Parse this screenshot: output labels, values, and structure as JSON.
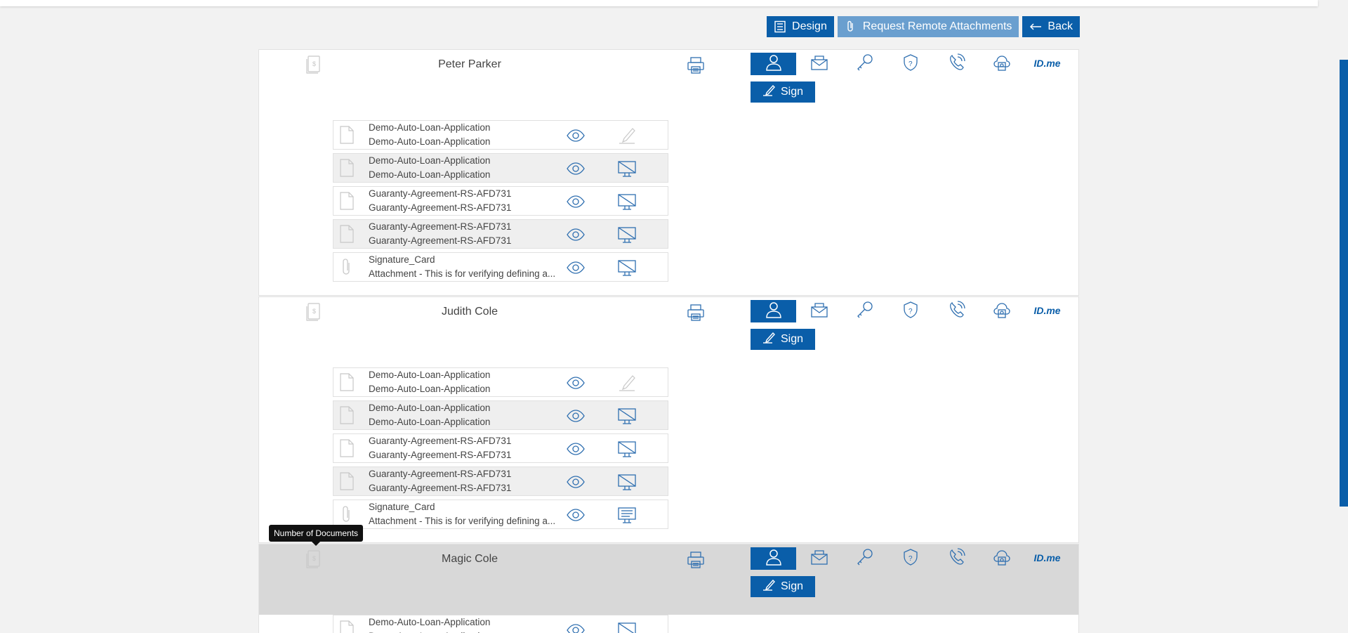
{
  "toolbar": {
    "design_label": "Design",
    "request_label": "Request Remote Attachments",
    "back_label": "Back"
  },
  "tooltip": "Number of Documents",
  "auth_methods": [
    "person-icon",
    "email-icon",
    "key-icon",
    "shield-question-icon",
    "phone-icon",
    "cloud-id-icon",
    "idme-logo"
  ],
  "idme": {
    "id": "ID",
    "me": ".me"
  },
  "sign_label": "Sign",
  "signers": [
    {
      "name": "Peter Parker",
      "docs": [
        {
          "line1": "Demo-Auto-Loan-Application",
          "line2": "Demo-Auto-Loan-Application",
          "icon": "file-icon",
          "action": "pen-icon"
        },
        {
          "line1": "Demo-Auto-Loan-Application",
          "line2": "Demo-Auto-Loan-Application",
          "icon": "file-icon",
          "action": "no-screen-icon"
        },
        {
          "line1": "Guaranty-Agreement-RS-AFD731",
          "line2": "Guaranty-Agreement-RS-AFD731",
          "icon": "file-icon",
          "action": "no-screen-icon"
        },
        {
          "line1": "Guaranty-Agreement-RS-AFD731",
          "line2": "Guaranty-Agreement-RS-AFD731",
          "icon": "file-icon",
          "action": "no-screen-icon"
        },
        {
          "line1": "Signature_Card",
          "line2": "Attachment - This is for verifying defining a...",
          "icon": "paperclip-icon",
          "action": "no-screen-icon"
        }
      ]
    },
    {
      "name": "Judith Cole",
      "docs": [
        {
          "line1": "Demo-Auto-Loan-Application",
          "line2": "Demo-Auto-Loan-Application",
          "icon": "file-icon",
          "action": "pen-icon"
        },
        {
          "line1": "Demo-Auto-Loan-Application",
          "line2": "Demo-Auto-Loan-Application",
          "icon": "file-icon",
          "action": "no-screen-icon"
        },
        {
          "line1": "Guaranty-Agreement-RS-AFD731",
          "line2": "Guaranty-Agreement-RS-AFD731",
          "icon": "file-icon",
          "action": "no-screen-icon"
        },
        {
          "line1": "Guaranty-Agreement-RS-AFD731",
          "line2": "Guaranty-Agreement-RS-AFD731",
          "icon": "file-icon",
          "action": "no-screen-icon"
        },
        {
          "line1": "Signature_Card",
          "line2": "Attachment - This is for verifying defining a...",
          "icon": "paperclip-icon",
          "action": "screen-text-icon"
        }
      ]
    },
    {
      "name": "Magic Cole",
      "docs": [
        {
          "line1": "Demo-Auto-Loan-Application",
          "line2": "Demo-Auto-Loan-Application",
          "icon": "file-icon",
          "action": "no-screen-icon"
        }
      ]
    }
  ],
  "colors": {
    "primary": "#0a5ea9",
    "light": "#6a9fcf",
    "icon": "#2f6fb0",
    "muted": "#c8c8c8"
  }
}
